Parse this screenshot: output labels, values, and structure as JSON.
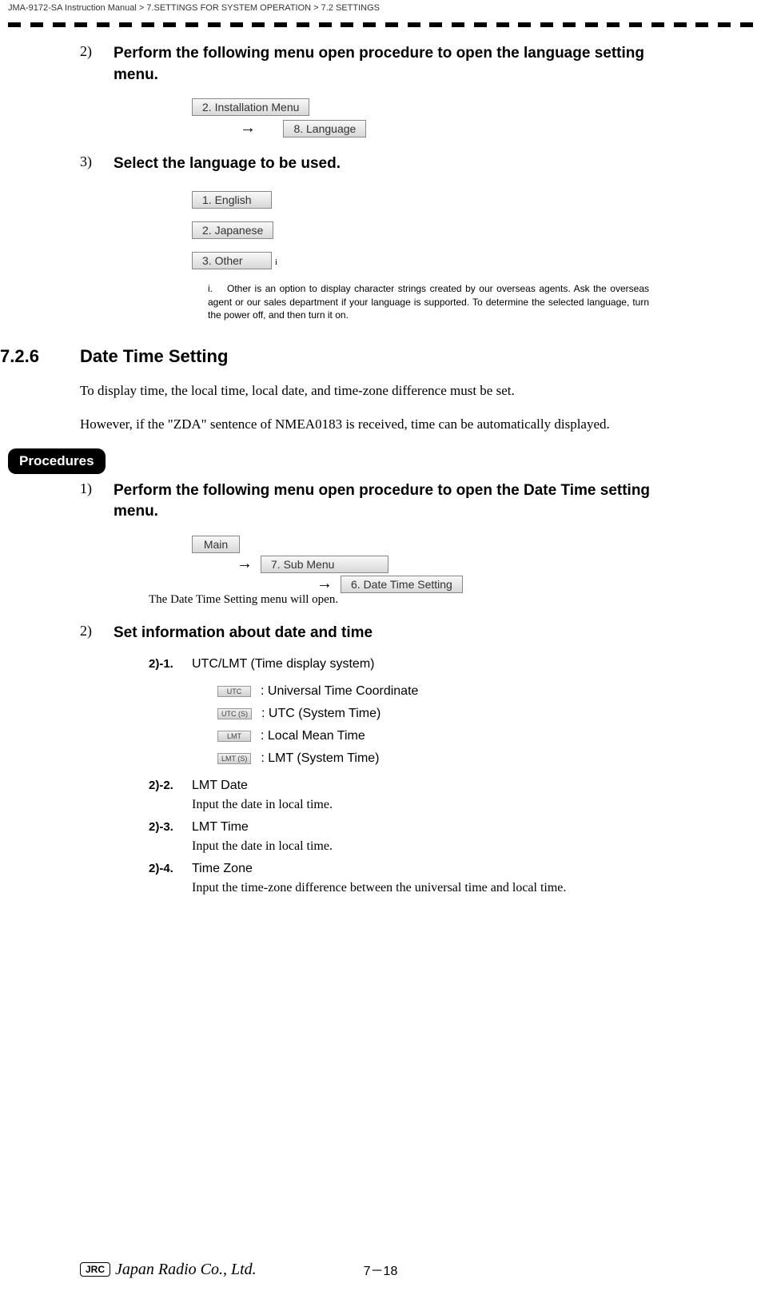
{
  "breadcrumb": "JMA-9172-SA Instruction Manual > 7.SETTINGS FOR SYSTEM OPERATION > 7.2  SETTINGS",
  "step2": {
    "num": "2)",
    "text": "Perform the following menu open procedure to open the language setting menu.",
    "btn1": "2. Installation Menu",
    "btn2": "8. Language"
  },
  "step3": {
    "num": "3)",
    "text": "Select the language to be used.",
    "opt1": "1. English",
    "opt2": "2. Japanese",
    "opt3": "3. Other",
    "sup": "i"
  },
  "footnote": {
    "num": "i.",
    "text": "Other is an option to display character strings created by our overseas agents. Ask the overseas agent or our sales department if your language is supported. To determine the selected language, turn the power off, and then turn it on."
  },
  "section": {
    "num": "7.2.6",
    "title": "Date Time Setting"
  },
  "body1": "To display time, the local time, local date, and time-zone difference must be set.",
  "body2": "However, if the \"ZDA\" sentence of NMEA0183 is received, time can be automatically displayed.",
  "procedures": "Procedures",
  "pstep1": {
    "num": "1)",
    "text": "Perform the following menu open procedure to open the Date Time setting menu.",
    "btn1": "Main",
    "btn2": "7. Sub Menu",
    "btn3": "6. Date Time Setting",
    "followup": "The Date Time Setting menu will open."
  },
  "pstep2": {
    "num": "2)",
    "text": "Set information about date and time"
  },
  "sub1": {
    "num": "2)-1.",
    "text": "UTC/LMT (Time display system)",
    "options": [
      {
        "btn": "UTC",
        "label": ": Universal Time Coordinate"
      },
      {
        "btn": "UTC (S)",
        "label": ": UTC (System Time)"
      },
      {
        "btn": "LMT",
        "label": ": Local Mean Time"
      },
      {
        "btn": "LMT (S)",
        "label": ": LMT (System Time)"
      }
    ]
  },
  "sub2": {
    "num": "2)-2.",
    "text": "LMT Date",
    "desc": "Input the date in local time."
  },
  "sub3": {
    "num": "2)-3.",
    "text": "LMT Time",
    "desc": "Input the date in local time."
  },
  "sub4": {
    "num": "2)-4.",
    "text": "Time Zone",
    "desc": "Input the time-zone difference between the universal time and local time."
  },
  "footer": {
    "jrc": "JRC",
    "company": "Japan Radio Co., Ltd.",
    "page": "7－18"
  }
}
